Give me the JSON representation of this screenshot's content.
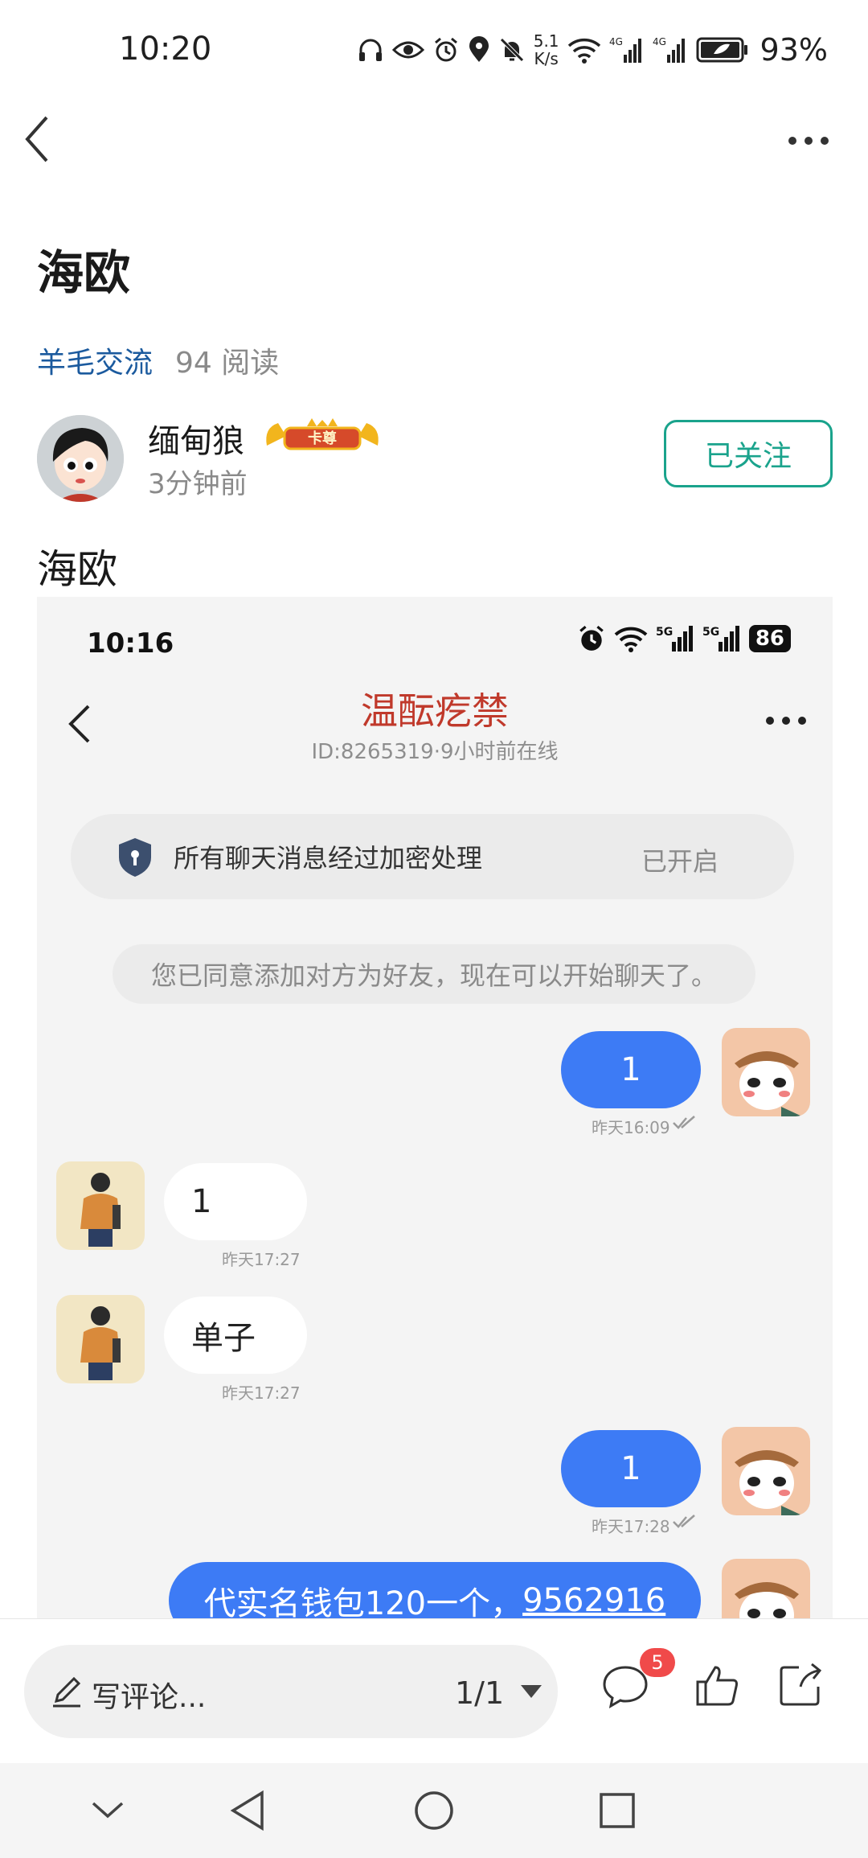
{
  "status_bar": {
    "time": "10:20",
    "net_speed_value": "5.1",
    "net_speed_unit": "K/s",
    "sim1": "4G",
    "sim2": "4G",
    "battery": "93%"
  },
  "post": {
    "title": "海欧",
    "category": "羊毛交流",
    "reads": "94 阅读",
    "author": {
      "name": "缅甸狼",
      "badge": "卡尊",
      "time": "3分钟前",
      "follow_label": "已关注"
    },
    "body": "海欧"
  },
  "screenshot": {
    "time": "10:16",
    "battery": "86",
    "sim1": "5G",
    "sim2": "5G",
    "chat_title": "温酝疙禁",
    "chat_subtitle": "ID:8265319·9小时前在线",
    "encryption_text": "所有聊天消息经过加密处理",
    "encryption_status": "已开启",
    "system_message": "您已同意添加对方为好友，现在可以开始聊天了。",
    "messages": [
      {
        "dir": "out",
        "text": "1",
        "time": "昨天16:09"
      },
      {
        "dir": "in",
        "text": "1",
        "time": "昨天17:27"
      },
      {
        "dir": "in",
        "text": "单子",
        "time": "昨天17:27"
      },
      {
        "dir": "out",
        "text": "1",
        "time": "昨天17:28"
      },
      {
        "dir": "out",
        "text": "代实名钱包120一个，",
        "link": "9562916"
      }
    ]
  },
  "bottom_bar": {
    "comment_placeholder": "写评论...",
    "page_indicator": "1/1",
    "comment_count": "5"
  },
  "icons": {
    "back": "back-icon",
    "more": "more-icon",
    "comment": "comment-icon",
    "like": "thumbs-up-icon",
    "share": "share-icon"
  },
  "colors": {
    "accent": "#1aa38c",
    "link": "#1b5a9e",
    "bubble_out": "#3d7bf5",
    "chat_title": "#c0392b",
    "badge": "#f04a4a"
  }
}
